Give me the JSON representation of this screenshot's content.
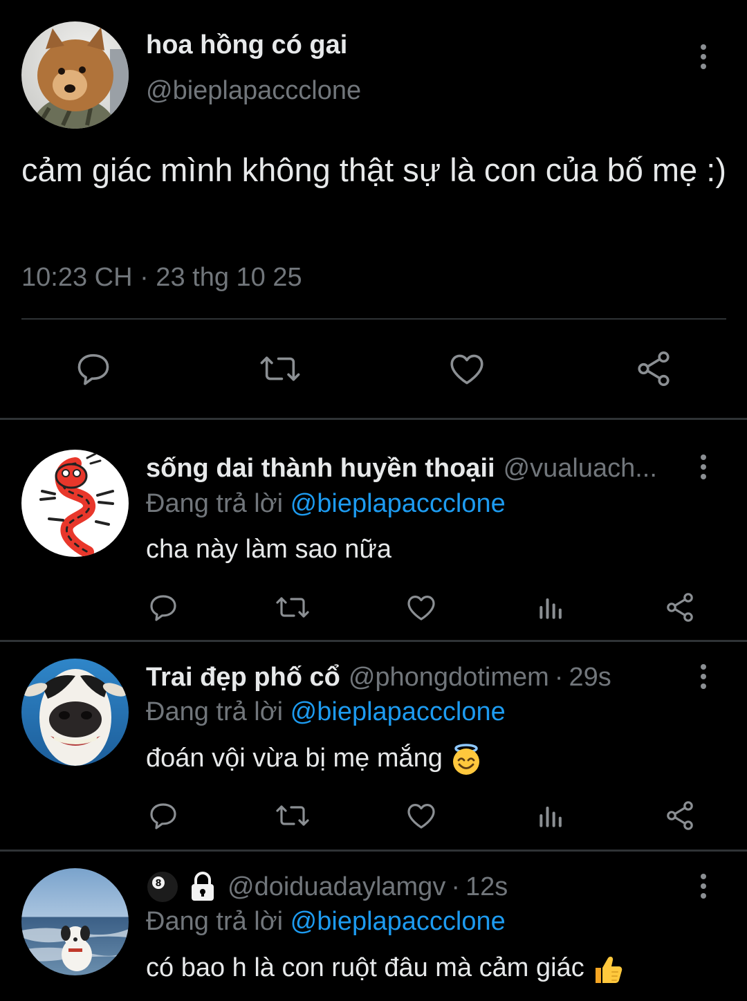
{
  "main_tweet": {
    "display_name": "hoa hồng có gai",
    "handle": "@bieplapaccclone",
    "text": "cảm giác mình không thật sự là con của bố mẹ :)",
    "timestamp": "10:23 CH · 23 thg 10 25",
    "avatar_icon": "pomeranian-dog-avatar",
    "actions": [
      "reply-icon",
      "retweet-icon",
      "like-icon",
      "share-icon"
    ]
  },
  "replies": [
    {
      "display_name": "sống dai thành huyền thoạii",
      "handle": "@vualuach...",
      "time": "",
      "replying_prefix": "Đang trả lời",
      "replying_to": "@bieplapaccclone",
      "text": "cha này làm sao nữa",
      "avatar_icon": "red-dragon-avatar"
    },
    {
      "display_name": "Trai đẹp phố cổ",
      "handle": "@phongdotimem",
      "time": "29s",
      "replying_prefix": "Đang trả lời",
      "replying_to": "@bieplapaccclone",
      "text": "đoán vội vừa bị mẹ mắng",
      "text_emoji": "smiling-face-with-halo",
      "avatar_icon": "cow-avatar"
    },
    {
      "display_name": "",
      "name_icons": [
        "8-ball-emoji",
        "lock-icon"
      ],
      "handle": "@doiduadaylamgv",
      "time": "12s",
      "replying_prefix": "Đang trả lời",
      "replying_to": "@bieplapaccclone",
      "text": "có bao h là con ruột đâu mà cảm giác",
      "text_emoji": "thumbs-up",
      "avatar_icon": "beach-plush-avatar"
    }
  ],
  "colors": {
    "background": "#000000",
    "text": "#e7e9ea",
    "secondary": "#71767b",
    "link": "#1d9bf0",
    "divider": "#2f3336"
  }
}
